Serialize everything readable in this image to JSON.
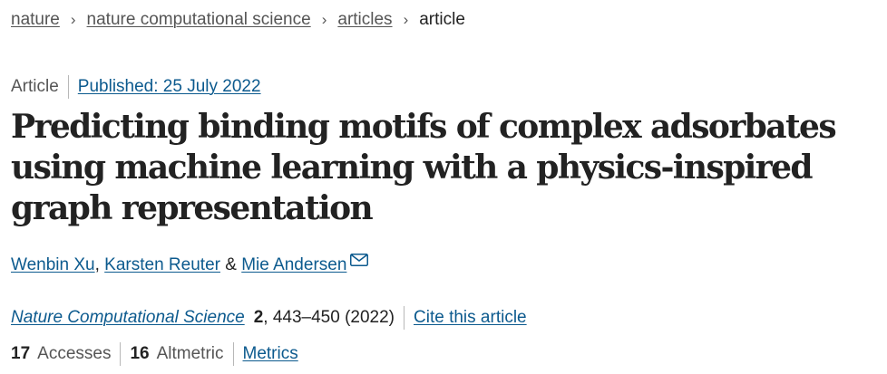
{
  "breadcrumb": {
    "items": [
      {
        "label": "nature"
      },
      {
        "label": "nature computational science"
      },
      {
        "label": "articles"
      }
    ],
    "current": "article",
    "separator": "›"
  },
  "article": {
    "type": "Article",
    "published": "Published: 25 July 2022",
    "title": "Predicting binding motifs of complex adsorbates using machine learning with a physics-inspired graph representation",
    "authors": [
      {
        "name": "Wenbin Xu"
      },
      {
        "name": "Karsten Reuter"
      },
      {
        "name": "Mie Andersen"
      }
    ],
    "author_separator": ",",
    "author_conjunction": "&",
    "contact_icon": "mail-icon"
  },
  "citation": {
    "journal": "Nature Computational Science",
    "volume": "2",
    "pages_year": ", 443–450 (2022)",
    "cite_label": "Cite this article"
  },
  "metrics": {
    "accesses_count": "17",
    "accesses_label": "Accesses",
    "altmetric_count": "16",
    "altmetric_label": "Altmetric",
    "metrics_link": "Metrics"
  },
  "colors": {
    "link": "#0c5a8e",
    "text": "#222222",
    "muted": "#555555",
    "divider": "#b8b8b8"
  }
}
